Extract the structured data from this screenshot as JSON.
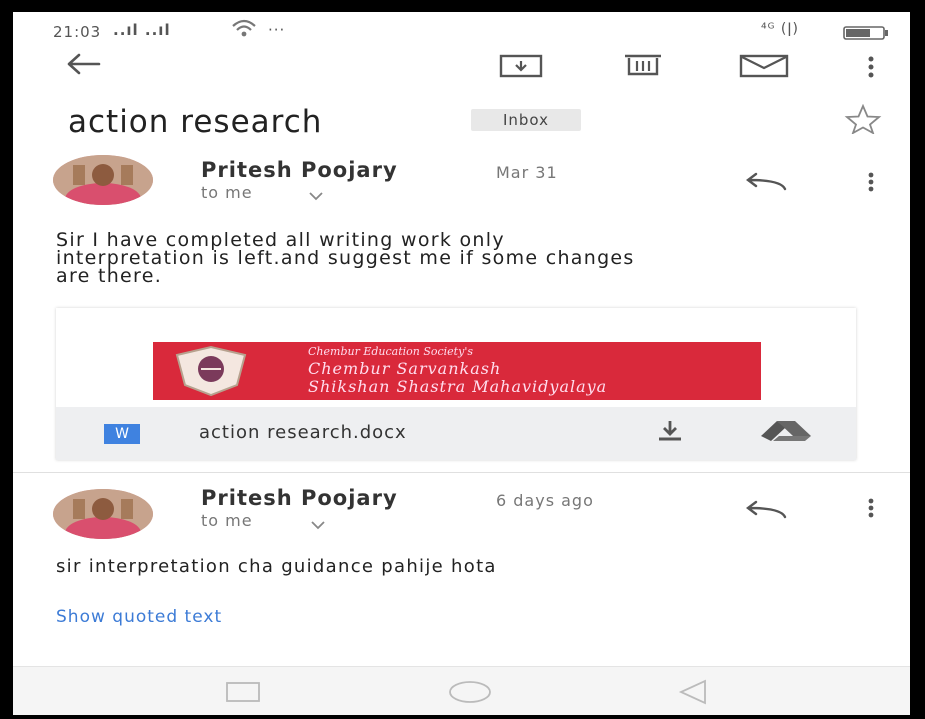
{
  "status_bar": {
    "time": "21:03",
    "signal": "..ıl ..ıl",
    "extra": "···",
    "right": "⁴ᴳ (ǀ)"
  },
  "toolbar": {
    "back_icon": "arrow-back-icon",
    "archive_icon": "archive-icon",
    "delete_icon": "trash-icon",
    "mail_icon": "mail-icon",
    "more_icon": "more-vert-icon"
  },
  "thread": {
    "subject": "action research",
    "label": "Inbox"
  },
  "messages": [
    {
      "sender": "Pritesh Poojary",
      "date": "Mar 31",
      "recipient": "to me",
      "body_lines": [
        "Sir I have completed all writing work only",
        "interpretation is left.and suggest me if some changes",
        "are there."
      ]
    },
    {
      "sender": "Pritesh Poojary",
      "date": "6 days ago",
      "recipient": "to me",
      "body": "sir interpretation cha guidance pahije hota",
      "quoted_link": "Show quoted text"
    }
  ],
  "attachment": {
    "banner_line1": "Chembur Education Society's",
    "banner_line2": "Chembur Sarvankash",
    "banner_line3": "Shikshan Shastra Mahavidyalaya",
    "file_badge": "W",
    "file_name": "action research.docx"
  },
  "colors": {
    "accent_link": "#3c7bd6",
    "banner_red": "#d9293b",
    "word_blue": "#3f82e0"
  }
}
